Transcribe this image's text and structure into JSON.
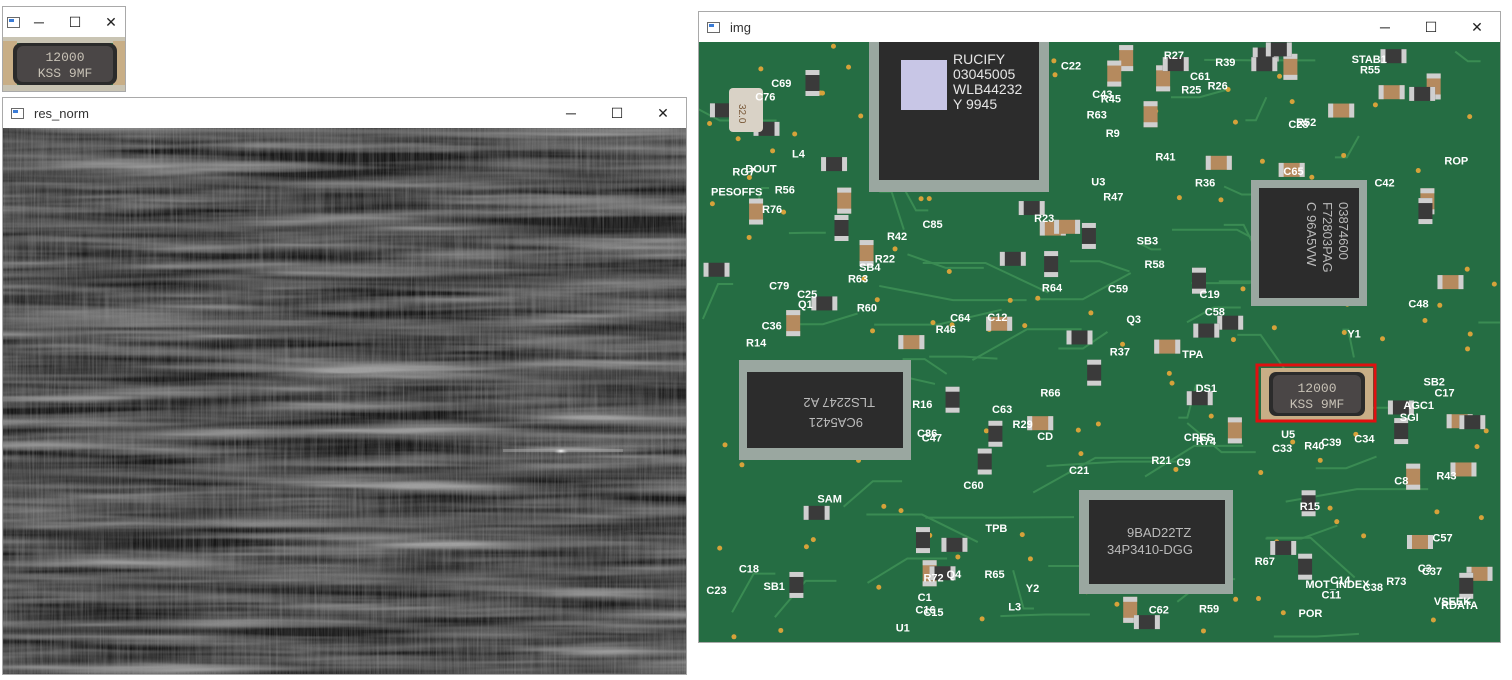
{
  "windows": {
    "template": {
      "title": "",
      "controls": {
        "minimize": "─",
        "maximize": "☐",
        "close": "✕"
      },
      "chip_text": [
        "12000",
        "KSS 9MF"
      ]
    },
    "res_norm": {
      "title": "res_norm",
      "controls": {
        "minimize": "─",
        "maximize": "☐",
        "close": "✕"
      }
    },
    "img": {
      "title": "img",
      "controls": {
        "minimize": "─",
        "maximize": "☐",
        "close": "✕"
      },
      "main_ic_text": [
        "RUCIFY",
        "03045005",
        "WLB44232",
        "Y 9945"
      ],
      "right_ic_text": [
        "03874600",
        "F72803PAG",
        "C 96A5VW"
      ],
      "left_ic_text": [
        "TLS2247 A2",
        "9CA5421"
      ],
      "bottom_ic_text": [
        "9BAD22TZ",
        "34P3410-DGG"
      ],
      "match_chip_text": [
        "12000",
        "KSS 9MF"
      ],
      "crystal_text": "32.0",
      "labels": [
        "MOT_INDEX",
        "SAM",
        "C57",
        "R36",
        "C58",
        "C33",
        "Y2",
        "C85",
        "R52",
        "U5",
        "AGC1",
        "L4",
        "C59",
        "C60",
        "C86",
        "R41",
        "R76",
        "C43",
        "C42",
        "STAB1",
        "C18",
        "C19",
        "U1",
        "POR",
        "C17",
        "C8",
        "R15",
        "R14",
        "R16",
        "C1",
        "C9",
        "C3",
        "C64",
        "C63",
        "C62",
        "R63",
        "C61",
        "C65",
        "RDATA",
        "R25",
        "C11",
        "DS1",
        "C12",
        "R63",
        "RG7",
        "ROP",
        "TPA",
        "C21",
        "R26",
        "R74",
        "R64",
        "SGI",
        "CD",
        "DOUT",
        "TPB",
        "C22",
        "R27",
        "Y1",
        "R42",
        "C34",
        "R37",
        "R29",
        "Q3",
        "SB1",
        "SB2",
        "SB4",
        "SB3",
        "R66",
        "R65",
        "U3",
        "C23",
        "C14",
        "R21",
        "CPES",
        "R56",
        "R55",
        "C48",
        "R45",
        "R43",
        "C47",
        "R40",
        "C36",
        "R22",
        "C15",
        "C37",
        "R23",
        "Q1",
        "R67",
        "C79",
        "R60",
        "R59",
        "R58",
        "R46",
        "L3",
        "C38",
        "R73",
        "R72",
        "C39",
        "C16",
        "R9",
        "Q4",
        "R47",
        "VSEEK",
        "C69",
        "C76",
        "C25",
        "C28",
        "R39",
        "PESOFFS"
      ]
    }
  }
}
